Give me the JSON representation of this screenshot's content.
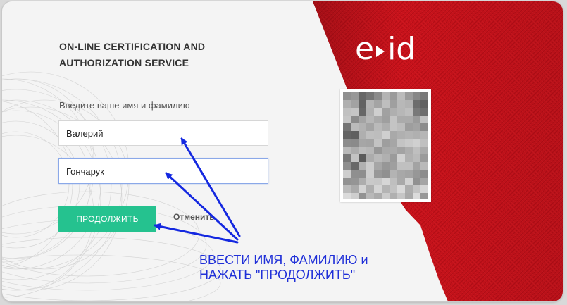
{
  "service": {
    "heading": "ON-LINE CERTIFICATION AND\nAUTHORIZATION SERVICE",
    "logo_left": "e",
    "logo_right": "id"
  },
  "form": {
    "name_label": "Введите ваше имя и фамилию",
    "first_name_value": "Валерий",
    "last_name_value": "Гончарук",
    "continue_label": "ПРОДОЛЖИТЬ",
    "cancel_label": "Отменить"
  },
  "annotation": {
    "text": "ВВЕСТИ ИМЯ, ФАМИЛИЮ и\nНАЖАТЬ \"ПРОДОЛЖИТЬ\""
  },
  "colors": {
    "brand_red": "#c8121b",
    "button_green": "#25c28f",
    "annotation_blue": "#1428e0"
  }
}
